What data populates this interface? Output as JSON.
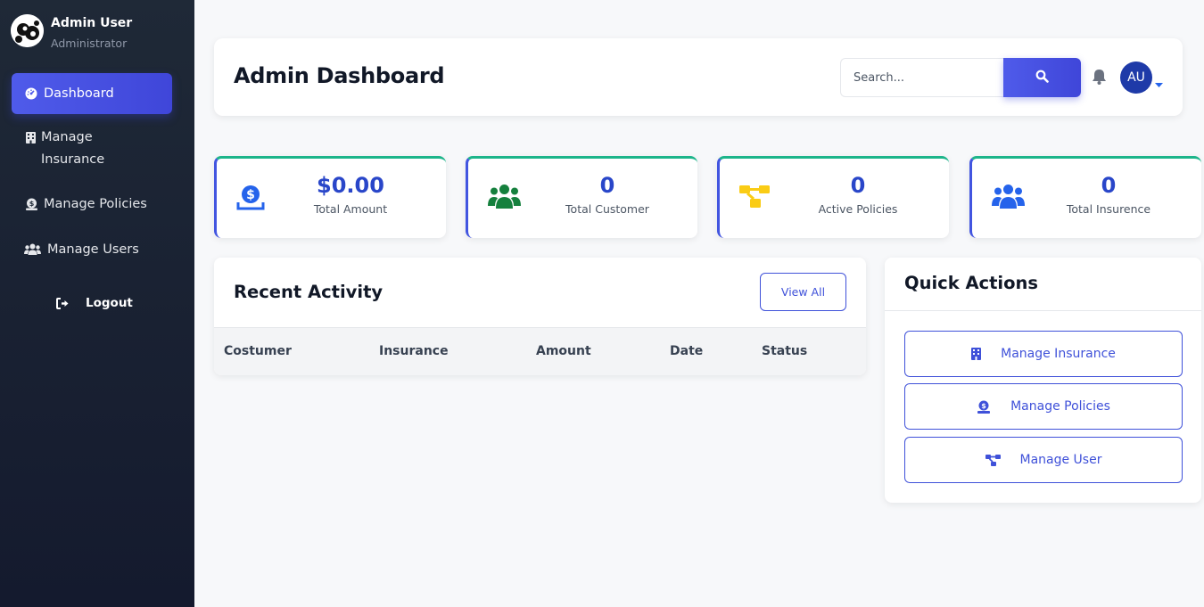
{
  "profile": {
    "name": "Admin User",
    "role": "Administrator"
  },
  "sidebar": {
    "items": [
      {
        "label": "Dashboard",
        "icon": "dashboard-gauge-icon",
        "active": true
      },
      {
        "label": "Manage Insurance",
        "icon": "building-icon",
        "active": false
      },
      {
        "label": "Manage Policies",
        "icon": "money-check-icon",
        "active": false
      },
      {
        "label": "Manage Users",
        "icon": "users-icon",
        "active": false
      }
    ],
    "logout": "Logout"
  },
  "header": {
    "title": "Admin Dashboard",
    "search_placeholder": "Search...",
    "user_initials": "AU"
  },
  "stats": [
    {
      "value": "$0.00",
      "label": "Total Amount",
      "icon": "money-hand-icon",
      "color": "#2563eb"
    },
    {
      "value": "0",
      "label": "Total Customer",
      "icon": "users-icon",
      "color": "#15803d"
    },
    {
      "value": "0",
      "label": "Active Policies",
      "icon": "sitemap-icon",
      "color": "#facc15"
    },
    {
      "value": "0",
      "label": "Total Insurence",
      "icon": "users-icon",
      "color": "#2563eb"
    }
  ],
  "activity": {
    "title": "Recent Activity",
    "view_all": "View All",
    "columns": [
      "Costumer",
      "Insurance",
      "Amount",
      "Date",
      "Status"
    ]
  },
  "quick_actions": {
    "title": "Quick Actions",
    "buttons": [
      {
        "label": "Manage Insurance",
        "icon": "building-icon"
      },
      {
        "label": "Manage Policies",
        "icon": "money-check-icon"
      },
      {
        "label": "Manage User",
        "icon": "sitemap-icon"
      }
    ]
  },
  "colors": {
    "accent": "#4255e0",
    "sidebar_bg": "#1a2236",
    "stat_border_top": "#1db58a"
  }
}
